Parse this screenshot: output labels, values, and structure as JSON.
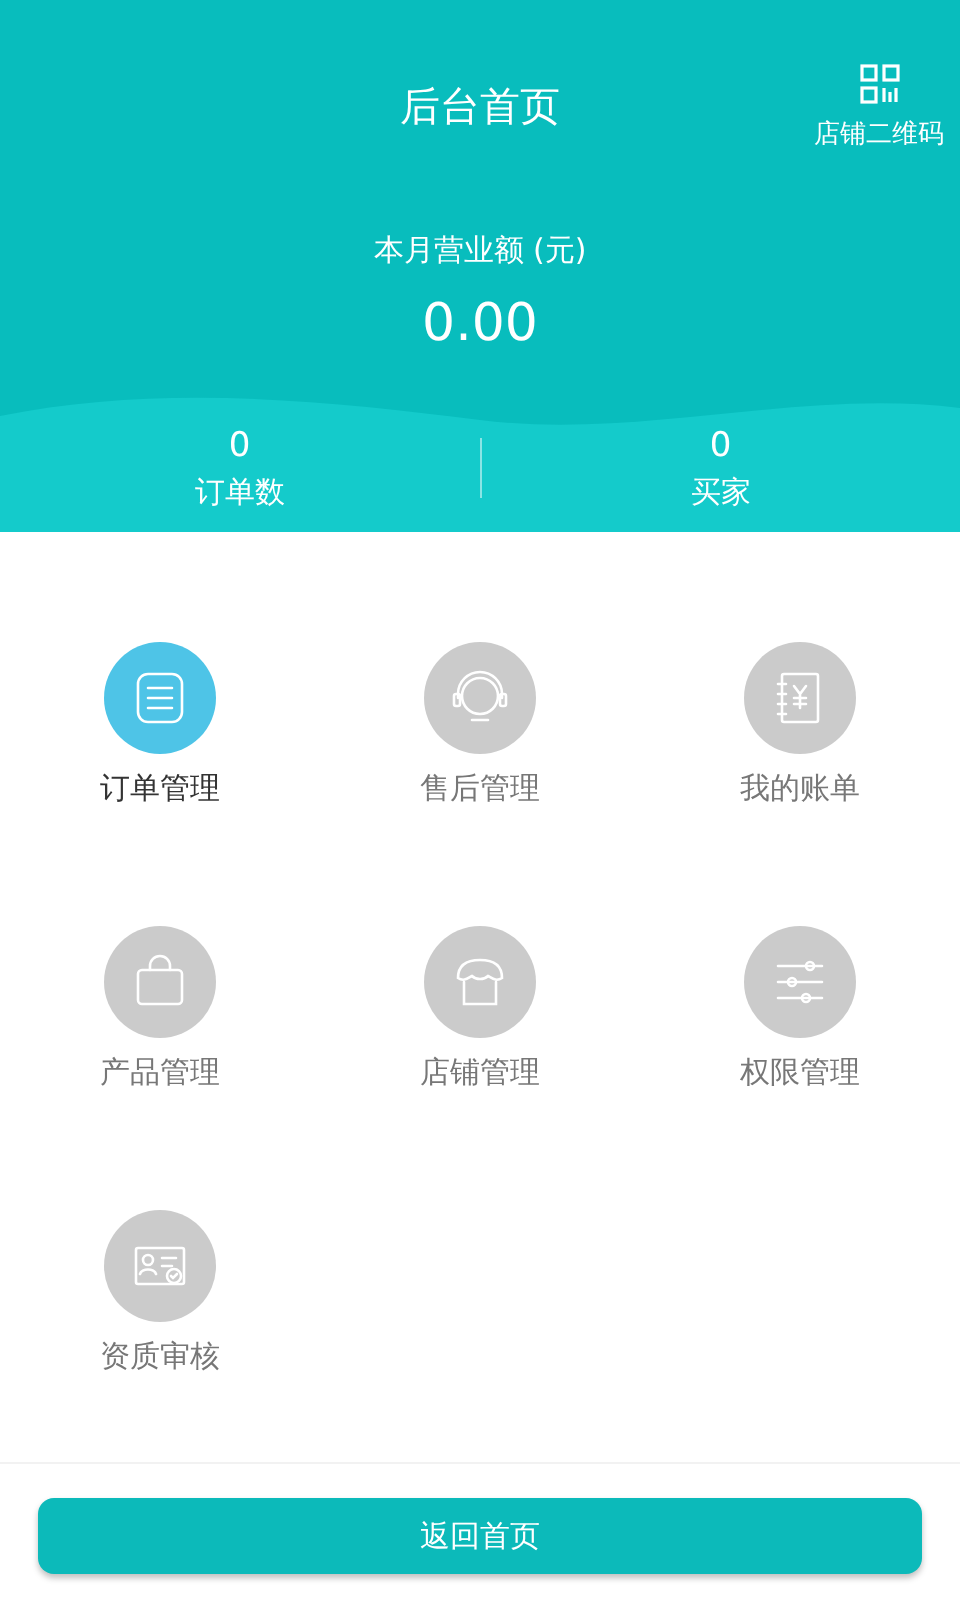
{
  "header": {
    "title": "后台首页",
    "qr_label": "店铺二维码",
    "revenue_label": "本月营业额 (元)",
    "revenue_value": "0.00"
  },
  "stats": [
    {
      "value": "0",
      "label": "订单数"
    },
    {
      "value": "0",
      "label": "买家"
    }
  ],
  "menu": [
    {
      "label": "订单管理",
      "selected": true
    },
    {
      "label": "售后管理",
      "selected": false
    },
    {
      "label": "我的账单",
      "selected": false
    },
    {
      "label": "产品管理",
      "selected": false
    },
    {
      "label": "店铺管理",
      "selected": false
    },
    {
      "label": "权限管理",
      "selected": false
    },
    {
      "label": "资质审核",
      "selected": false
    }
  ],
  "bottom_button": "返回首页"
}
